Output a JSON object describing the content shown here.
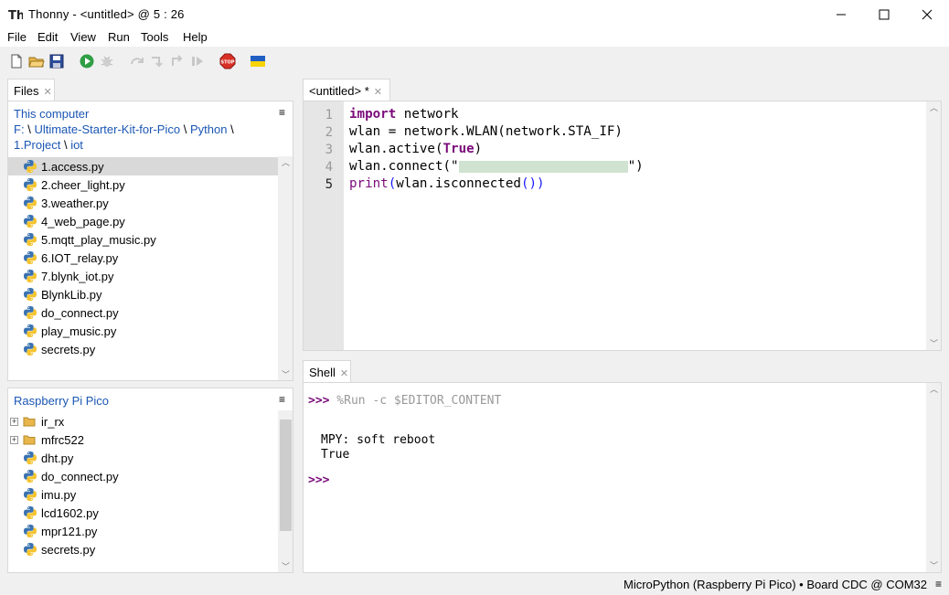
{
  "window": {
    "title": "Thonny  -  <untitled>  @  5 : 26",
    "app_icon": "thonny-icon",
    "controls": [
      "minimize-icon",
      "maximize-icon",
      "close-icon"
    ]
  },
  "menu": {
    "file": "File",
    "edit": "Edit",
    "view": "View",
    "run": "Run",
    "tools": "Tools",
    "help": "Help"
  },
  "toolbar": {
    "buttons": [
      "new-file-icon",
      "open-file-icon",
      "save-icon",
      "run-icon",
      "debug-icon",
      "step-over-icon",
      "step-into-icon",
      "step-out-icon",
      "resume-icon",
      "stop-icon",
      "ukraine-flag-icon"
    ],
    "stop_label": "STOP"
  },
  "files_panel": {
    "tab_label": "Files",
    "computer": {
      "header": "This computer",
      "path": {
        "drive": "F:",
        "sep": "\\",
        "seg1": "Ultimate-Starter-Kit-for-Pico",
        "seg2": "Python",
        "seg3": "1.Project",
        "seg4": "iot"
      },
      "files": [
        "1.access.py",
        "2.cheer_light.py",
        "3.weather.py",
        "4_web_page.py",
        "5.mqtt_play_music.py",
        "6.IOT_relay.py",
        "7.blynk_iot.py",
        "BlynkLib.py",
        "do_connect.py",
        "play_music.py",
        "secrets.py"
      ],
      "selected": "1.access.py"
    },
    "device": {
      "header": "Raspberry Pi Pico",
      "folders": [
        "ir_rx",
        "mfrc522"
      ],
      "files": [
        "dht.py",
        "do_connect.py",
        "imu.py",
        "lcd1602.py",
        "mpr121.py",
        "secrets.py"
      ]
    }
  },
  "editor": {
    "tab_label": "<untitled> *",
    "line_numbers": [
      "1",
      "2",
      "3",
      "4",
      "5"
    ],
    "code": {
      "l1_kw": "import",
      "l1_rest": " network",
      "l2": "wlan = network.WLAN(network.STA_IF)",
      "l3_a": "wlan.active(",
      "l3_kw": "True",
      "l3_b": ")",
      "l4_a": "wlan.connect(\"",
      "l4_b": "\")",
      "l5_fn": "print",
      "l5_p1": "(",
      "l5_mid": "wlan.isconnected",
      "l5_p2": "())"
    }
  },
  "shell": {
    "tab_label": "Shell",
    "prompt": ">>>",
    "command": " %Run -c $EDITOR_CONTENT",
    "output": [
      "MPY: soft reboot",
      "True"
    ]
  },
  "status": {
    "interpreter": "MicroPython (Raspberry Pi Pico)  •  Board CDC @ COM32",
    "menu_icon": "≡"
  }
}
